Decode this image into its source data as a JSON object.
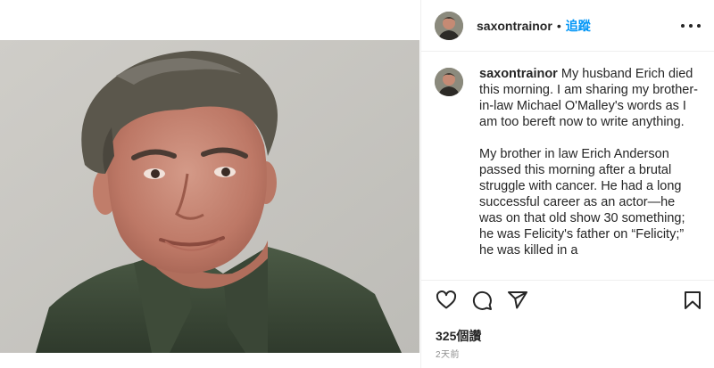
{
  "header": {
    "username": "saxontrainor",
    "separator": "•",
    "follow_label": "追蹤",
    "more_icon": "more-options-icon"
  },
  "caption": {
    "username": "saxontrainor",
    "paragraph_1": "My husband Erich died this morning. I am sharing my brother-in-law Michael O'Malley's words as I am too bereft now to write anything.",
    "paragraph_2": "My brother in law Erich Anderson passed this morning after a brutal struggle with cancer. He had a long successful career as an actor—he was on that old show 30 something; he was Felicity's father on “Felicity;” he was killed in a"
  },
  "actions": {
    "icons": [
      "heart-icon",
      "comment-icon",
      "share-icon",
      "bookmark-icon"
    ],
    "likes_label": "325個讚",
    "time_label": "2天前"
  },
  "colors": {
    "accent": "#0095f6",
    "text": "#262626",
    "muted": "#8e8e8e"
  }
}
